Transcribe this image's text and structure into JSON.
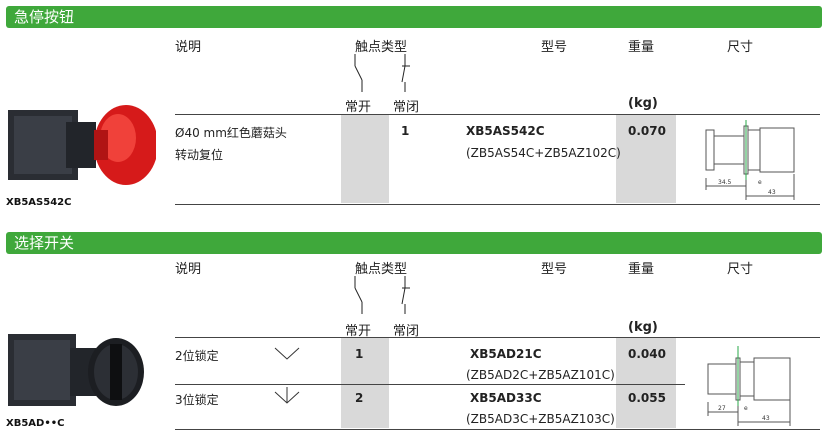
{
  "section1": {
    "title": "急停按钮",
    "headers": {
      "desc": "说明",
      "contact_type": "触点类型",
      "model": "型号",
      "weight": "重量",
      "size": "尺寸"
    },
    "sub_no": "常开",
    "sub_nc": "常闭",
    "weight_unit": "(kg)",
    "desc_line1": "Ø40 mm红色蘑菇头",
    "desc_line2": "转动复位",
    "nc_value": "1",
    "model_main": "XB5AS542C",
    "model_sub": "(ZB5AS54C+ZB5AZ102C)",
    "weight_value": "0.070",
    "product_caption": "XB5AS542C",
    "dims": {
      "a": "34.5",
      "e": "e",
      "b": "43"
    }
  },
  "section2": {
    "title": "选择开关",
    "headers": {
      "desc": "说明",
      "contact_type": "触点类型",
      "model": "型号",
      "weight": "重量",
      "size": "尺寸"
    },
    "sub_no": "常开",
    "sub_nc": "常闭",
    "weight_unit": "(kg)",
    "rows": [
      {
        "desc": "2位锁定",
        "no": "1",
        "model_main": "XB5AD21C",
        "model_sub": "(ZB5AD2C+ZB5AZ101C)",
        "weight": "0.040"
      },
      {
        "desc": "3位锁定",
        "no": "2",
        "model_main": "XB5AD33C",
        "model_sub": "(ZB5AD3C+ZB5AZ103C)",
        "weight": "0.055"
      }
    ],
    "product_caption": "XB5AD••C",
    "dims": {
      "a": "27",
      "e": "e",
      "b": "43"
    }
  }
}
